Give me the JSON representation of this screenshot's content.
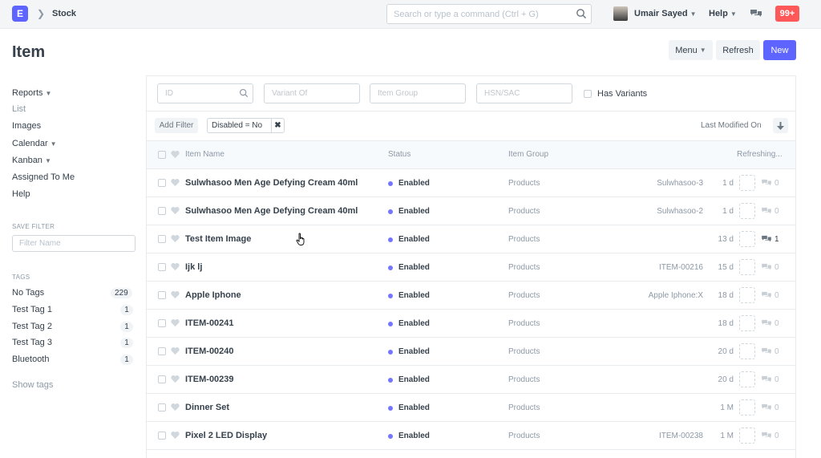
{
  "navbar": {
    "logo_letter": "E",
    "breadcrumb": "Stock",
    "search_placeholder": "Search or type a command (Ctrl + G)",
    "user_name": "Umair Sayed",
    "help_label": "Help",
    "notification_count": "99+"
  },
  "page": {
    "title": "Item",
    "menu_label": "Menu",
    "refresh_label": "Refresh",
    "new_label": "New"
  },
  "sidebar": {
    "reports": "Reports",
    "list": "List",
    "images": "Images",
    "calendar": "Calendar",
    "kanban": "Kanban",
    "assigned": "Assigned To Me",
    "help": "Help",
    "save_filter_heading": "SAVE FILTER",
    "filter_name_placeholder": "Filter Name",
    "tags_heading": "TAGS",
    "tags": [
      {
        "label": "No Tags",
        "count": "229"
      },
      {
        "label": "Test Tag 1",
        "count": "1"
      },
      {
        "label": "Test Tag 2",
        "count": "1"
      },
      {
        "label": "Test Tag 3",
        "count": "1"
      },
      {
        "label": "Bluetooth",
        "count": "1"
      }
    ],
    "show_tags": "Show tags"
  },
  "filters": {
    "id_placeholder": "ID",
    "variant_placeholder": "Variant Of",
    "group_placeholder": "Item Group",
    "hsn_placeholder": "HSN/SAC",
    "has_variants_label": "Has Variants",
    "add_filter_label": "Add Filter",
    "active_filter": "Disabled = No",
    "sort_label": "Last Modified On"
  },
  "list": {
    "headers": {
      "name": "Item Name",
      "status": "Status",
      "group": "Item Group",
      "refreshing": "Refreshing..."
    },
    "rows": [
      {
        "name": "Sulwhasoo Men Age Defying Cream 40ml",
        "status": "Enabled",
        "group": "Products",
        "variant": "Sulwhasoo-3",
        "time": "1 d",
        "comments": "0"
      },
      {
        "name": "Sulwhasoo Men Age Defying Cream 40ml",
        "status": "Enabled",
        "group": "Products",
        "variant": "Sulwhasoo-2",
        "time": "1 d",
        "comments": "0"
      },
      {
        "name": "Test Item Image",
        "status": "Enabled",
        "group": "Products",
        "variant": "",
        "time": "13 d",
        "comments": "1"
      },
      {
        "name": "Ijk lj",
        "status": "Enabled",
        "group": "Products",
        "variant": "ITEM-00216",
        "time": "15 d",
        "comments": "0"
      },
      {
        "name": "Apple Iphone",
        "status": "Enabled",
        "group": "Products",
        "variant": "Apple Iphone:X",
        "time": "18 d",
        "comments": "0"
      },
      {
        "name": "ITEM-00241",
        "status": "Enabled",
        "group": "Products",
        "variant": "",
        "time": "18 d",
        "comments": "0"
      },
      {
        "name": "ITEM-00240",
        "status": "Enabled",
        "group": "Products",
        "variant": "",
        "time": "20 d",
        "comments": "0"
      },
      {
        "name": "ITEM-00239",
        "status": "Enabled",
        "group": "Products",
        "variant": "",
        "time": "20 d",
        "comments": "0"
      },
      {
        "name": "Dinner Set",
        "status": "Enabled",
        "group": "Products",
        "variant": "",
        "time": "1 M",
        "comments": "0"
      },
      {
        "name": "Pixel 2 LED Display",
        "status": "Enabled",
        "group": "Products",
        "variant": "ITEM-00238",
        "time": "1 M",
        "comments": "0"
      }
    ]
  },
  "colors": {
    "accent": "#5e64ff",
    "notification": "#ff5858",
    "enabled_dot": "#7575ff"
  }
}
